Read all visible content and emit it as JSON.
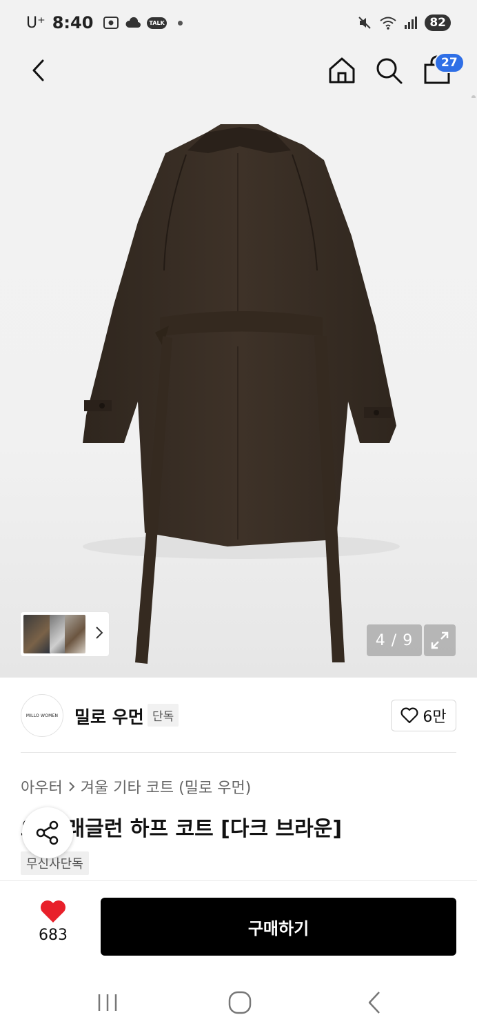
{
  "status_bar": {
    "carrier": "U⁺",
    "time": "8:40",
    "battery": "82",
    "talk_label": "TALK"
  },
  "header": {
    "cart_count": "27"
  },
  "gallery": {
    "counter": "4 / 9"
  },
  "brand": {
    "logo_text": "MILLO WOMEN",
    "name": "밀로 우먼",
    "tag": "단독",
    "likes": "6만"
  },
  "product": {
    "breadcrumb": [
      "아우터",
      "겨울 기타 코트 (밀로 우먼)"
    ],
    "title": "오버 래글런 하프 코트 [다크 브라운]",
    "exclusive_tag": "무신사단독"
  },
  "purchase": {
    "heart_count": "683",
    "buy_label": "구매하기"
  },
  "colors": {
    "accent_blue": "#2f6fe6",
    "heart_red": "#e8202a",
    "coat_brown": "#3b3026"
  }
}
